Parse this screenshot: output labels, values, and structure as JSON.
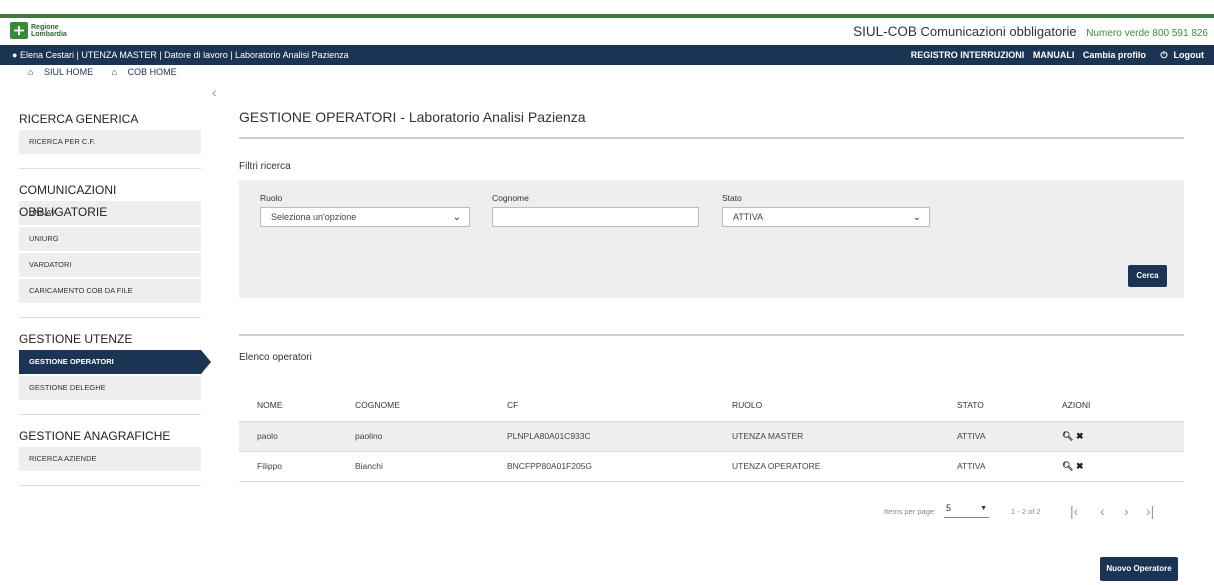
{
  "header": {
    "logo_line1": "Regione",
    "logo_line2": "Lombardia",
    "app_name": "SIUL-COB",
    "app_subtitle": "Comunicazioni obbligatorie",
    "numero_verde": "Numero verde 800 591 826"
  },
  "userbar": {
    "user_info": "Elena Cestari | UTENZA MASTER | Datore di lavoro | Laboratorio Analisi Pazienza",
    "links": [
      "REGISTRO INTERRUZIONI",
      "MANUALI",
      "Cambia profilo",
      "Logout"
    ]
  },
  "homes": [
    "SIUL HOME",
    "COB HOME"
  ],
  "sidebar": {
    "sections": [
      {
        "title": "RICERCA GENERICA",
        "items": [
          "RICERCA PER C.F."
        ]
      },
      {
        "title": "COMUNICAZIONI OBBLIGATORIE",
        "items": [
          "UNILAV",
          "UNIURG",
          "VARDATORI",
          "CARICAMENTO COB DA FILE"
        ]
      },
      {
        "title": "GESTIONE UTENZE",
        "items": [
          "GESTIONE OPERATORI",
          "GESTIONE DELEGHE"
        ]
      },
      {
        "title": "GESTIONE ANAGRAFICHE",
        "items": [
          "RICERCA AZIENDE"
        ]
      }
    ],
    "active_item": "GESTIONE OPERATORI"
  },
  "main": {
    "title": "GESTIONE OPERATORI - Laboratorio Analisi Pazienza",
    "filtri_label": "Filtri ricerca",
    "filters": {
      "ruolo_label": "Ruolo",
      "ruolo_value": "Seleziona un'opzione",
      "cognome_label": "Cognome",
      "cognome_value": "",
      "stato_label": "Stato",
      "stato_value": "ATTIVA",
      "cerca": "Cerca"
    },
    "elenco_label": "Elenco operatori",
    "columns": [
      "NOME",
      "COGNOME",
      "CF",
      "RUOLO",
      "STATO",
      "AZIONI"
    ],
    "rows": [
      {
        "nome": "paolo",
        "cognome": "paolino",
        "cf": "PLNPLA80A01C933C",
        "ruolo": "UTENZA MASTER",
        "stato": "ATTIVA"
      },
      {
        "nome": "Filippo",
        "cognome": "Bianchi",
        "cf": "BNCFPP80A01F205G",
        "ruolo": "UTENZA OPERATORE",
        "stato": "ATTIVA"
      }
    ],
    "pager": {
      "items_per_page_label": "Items per page:",
      "items_per_page": "5",
      "range": "1 - 2 of 2"
    },
    "nuovo_operatore": "Nuovo Operatore"
  }
}
